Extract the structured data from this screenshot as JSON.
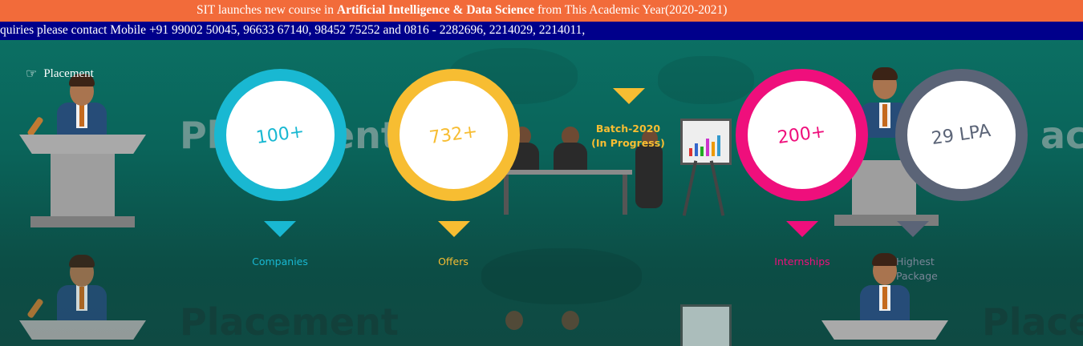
{
  "announcement": {
    "prefix": "SIT launches new course in ",
    "course": "Artificial Intelligence & Data Science",
    "suffix": " from This Academic Year(2020-2021)"
  },
  "ticker": {
    "text": "quiries please contact Mobile +91 99002 50045, 96633 67140, 98452 75252 and 0816 - 2282696, 2214029, 2214011,"
  },
  "placement_link": {
    "icon": "hand-point-right-icon",
    "label": "Placement"
  },
  "background_words": [
    "Placement",
    "Placement",
    "Placer",
    "acer"
  ],
  "stats": [
    {
      "value": "100+",
      "label": "Companies",
      "color": "#19b8d2"
    },
    {
      "value": "732+",
      "label": "Offers",
      "color": "#f7bd32"
    },
    {
      "value": "200+",
      "label": "Internships",
      "color": "#ef0f7c"
    },
    {
      "value": "29 LPA",
      "label_line1": "Highest",
      "label_line2": "Package",
      "color": "#5b6477"
    }
  ],
  "batch": {
    "line1": "Batch-2020",
    "line2": "(In Progress)",
    "color": "#f7bd32"
  }
}
